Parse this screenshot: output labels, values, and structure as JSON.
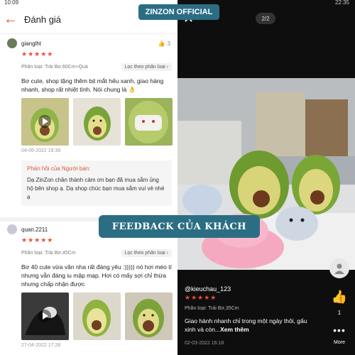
{
  "left": {
    "status_time": "10:09",
    "title": "Đánh giá",
    "reviews": [
      {
        "user": "gianglht",
        "likes": "3",
        "stars": "★★★★★",
        "classification": "Phân loại: Trái Bơ,60Cm+Quà",
        "filter": "Lọc theo phân loại",
        "text": "Bơ cute, shop tặng thêm bịt mắt hếu xanh, giao hàng nhanh, shop rất nhiệt tình. Nói chung là 👌",
        "date": "04-05-2022 19:39",
        "reply_title": "Phản hồi của Người bán:",
        "reply_text": "Dạ ZinZon chân thành cảm ơn bạn đã mua sắm ủng hộ bên shop ạ. Dạ shop chúc bạn mua sắm vui vẻ nhé ạ"
      },
      {
        "user": "quan.2211",
        "stars": "★★★★★",
        "classification": "Phân loại: Trái Bơ,45Cm",
        "filter": "Lọc theo phân loại",
        "text": "Bơ 40 cute vừa văn nha rất đáng yêu :))))) nó hơi méo tí nhưng vẫn đáng iu mập mạp. Hơi có mấy sợi chỉ thừa nhưng chấp nhận được",
        "date": "27-04-2022 17:28"
      }
    ]
  },
  "overlay": {
    "brand": "ZINZON OFFICIAL",
    "banner": "FEEDBACK CỦA KHÁCH"
  },
  "right": {
    "status_time": "22:35",
    "counter": "2/2",
    "user": "@kieuchau_123",
    "stars": "★★★★★",
    "classification": "Phân loại: Trái Bơ,35Cm",
    "text": "Giao hành nhanh chỉ trong một ngày thôi, gấu xinh và còn...",
    "see_more": "Xem thêm",
    "date": "02-03-2022 16:18",
    "like_count": "1",
    "more_label": "More"
  },
  "colors": {
    "accent": "#ee4d2d",
    "banner": "#2b6e84",
    "avocado": "#7aa33a"
  }
}
